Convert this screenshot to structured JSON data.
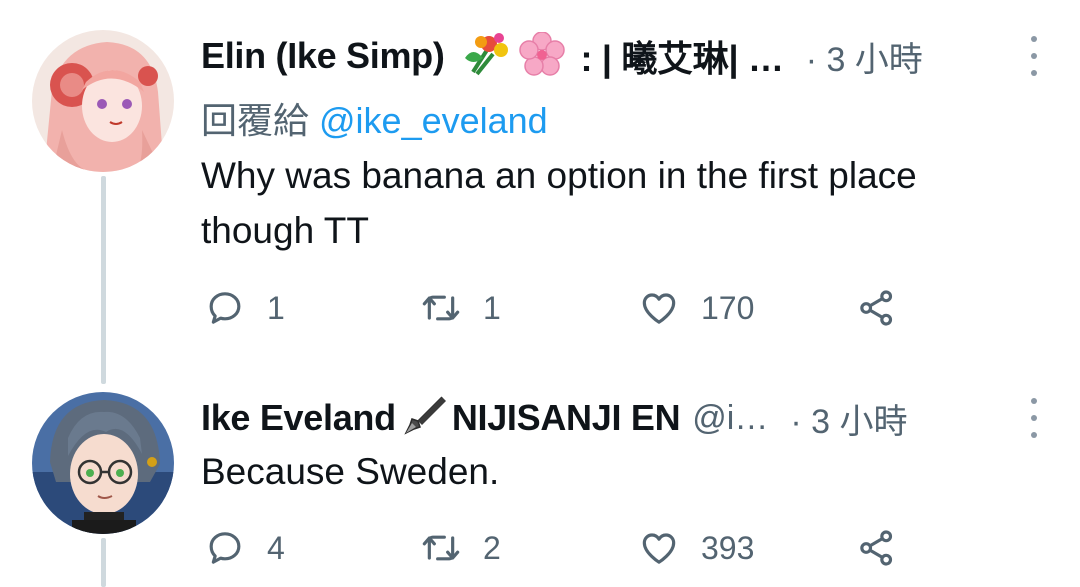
{
  "tweets": [
    {
      "display_name": "Elin (Ike Simp)",
      "name_suffix": ": | 曦艾琳| …",
      "time": "· 3 小時",
      "reply_label": "回覆給",
      "reply_mention": "@ike_eveland",
      "text_lines": [
        "Why was banana an option in the first place",
        "though TT"
      ],
      "replies": "1",
      "retweets": "1",
      "likes": "170"
    },
    {
      "display_name": "Ike Eveland",
      "name_suffix": "NIJISANJI EN",
      "handle": "@i…",
      "time": "· 3 小時",
      "text_lines": [
        "Because Sweden."
      ],
      "replies": "4",
      "retweets": "2",
      "likes": "393"
    }
  ],
  "icons": {
    "reply": "reply-icon",
    "retweet": "retweet-icon",
    "like": "heart-icon",
    "share": "share-icon",
    "more": "more-options-icon",
    "emoji_1": "bouquet-icon",
    "emoji_2": "cherry-blossom-icon",
    "emoji_3": "fountain-pen-icon"
  },
  "colors": {
    "text": "#0f1419",
    "secondary": "#536471",
    "link": "#1d9bf0",
    "thread_line": "#cfd9de"
  }
}
